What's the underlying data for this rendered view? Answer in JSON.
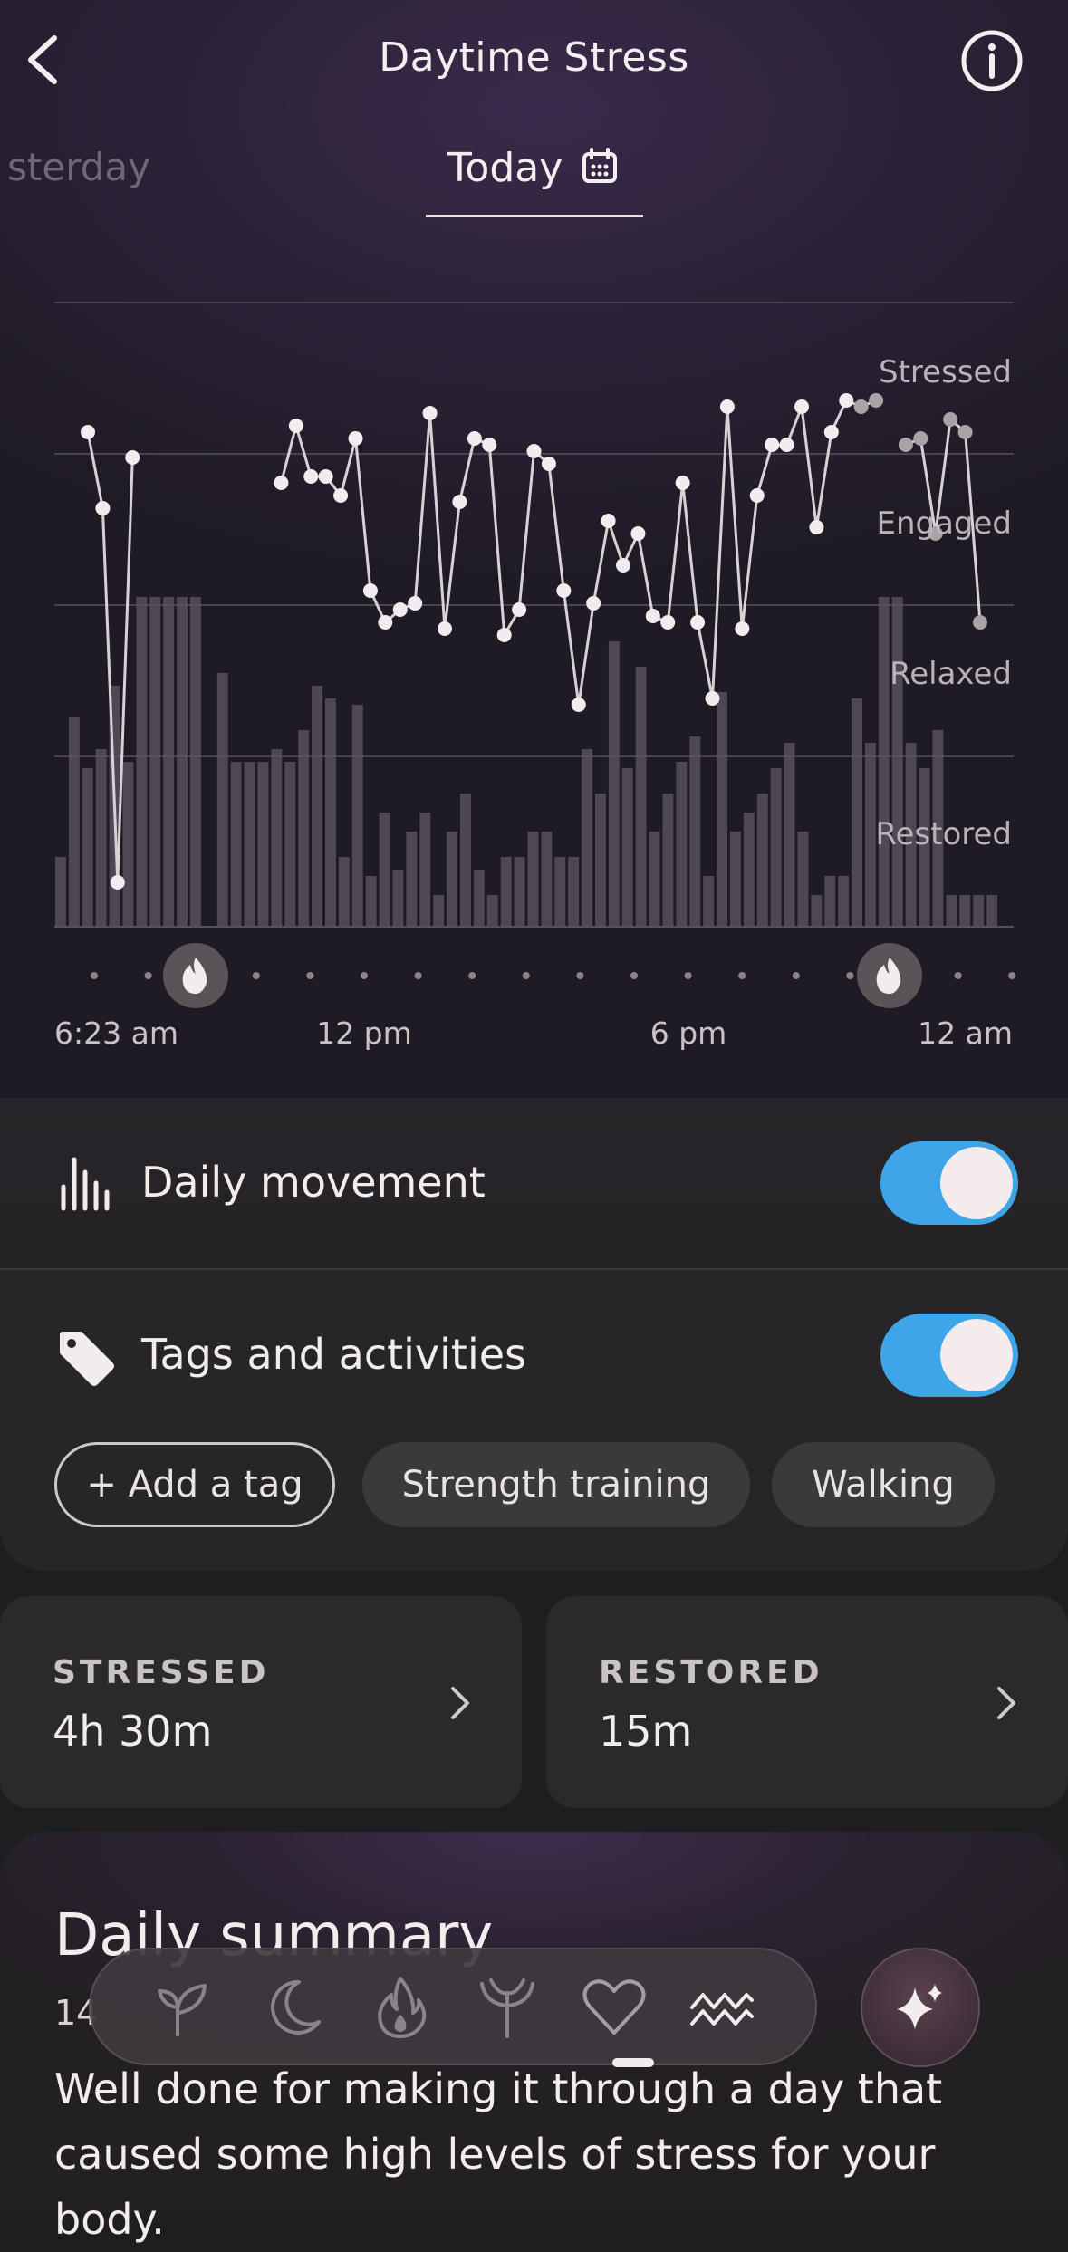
{
  "header": {
    "title": "Daytime Stress",
    "back_icon": "chevron-left-icon",
    "info_icon": "info-icon"
  },
  "tabs": {
    "previous_label": "sterday",
    "current_label": "Today",
    "calendar_icon": "calendar-icon"
  },
  "chart_data": {
    "type": "line",
    "y_levels": [
      "Stressed",
      "Engaged",
      "Relaxed",
      "Restored"
    ],
    "x_tick_labels": [
      "6:23 am",
      "12 pm",
      "6 pm",
      "12 am"
    ],
    "workout_markers": [
      "flame-icon",
      "flame-icon"
    ],
    "series": [
      {
        "kind": "stress-line",
        "values": [
          0.78,
          0.66,
          0.07,
          0.74,
          null,
          null,
          null,
          null,
          null,
          null,
          null,
          null,
          null,
          0.7,
          0.79,
          0.71,
          0.71,
          0.68,
          0.77,
          0.53,
          0.48,
          0.5,
          0.51,
          0.81,
          0.47,
          0.67,
          0.77,
          0.76,
          0.46,
          0.5,
          0.75,
          0.73,
          0.53,
          0.35,
          0.51,
          0.64,
          0.57,
          0.62,
          0.49,
          0.48,
          0.7,
          0.48,
          0.36,
          0.82,
          0.47,
          0.68,
          0.76,
          0.76,
          0.82,
          0.63,
          0.78,
          0.83,
          0.82,
          0.83,
          null,
          0.76,
          0.77,
          0.62,
          0.8,
          0.78,
          0.48
        ]
      },
      {
        "kind": "movement-bars",
        "values": [
          0.11,
          0.33,
          0.25,
          0.28,
          0.38,
          0.26,
          0.52,
          0.52,
          0.52,
          0.52,
          0.52,
          0.0,
          0.4,
          0.26,
          0.26,
          0.26,
          0.28,
          0.26,
          0.31,
          0.38,
          0.36,
          0.11,
          0.35,
          0.08,
          0.18,
          0.09,
          0.15,
          0.18,
          0.05,
          0.15,
          0.21,
          0.09,
          0.05,
          0.11,
          0.11,
          0.15,
          0.15,
          0.11,
          0.11,
          0.28,
          0.21,
          0.45,
          0.25,
          0.41,
          0.15,
          0.21,
          0.26,
          0.3,
          0.08,
          0.37,
          0.15,
          0.18,
          0.21,
          0.25,
          0.29,
          0.15,
          0.05,
          0.08,
          0.08,
          0.36,
          0.29,
          0.52,
          0.52,
          0.29,
          0.25,
          0.31,
          0.05,
          0.05,
          0.05,
          0.05
        ]
      }
    ]
  },
  "movement": {
    "icon": "activity-bars-icon",
    "label": "Daily movement",
    "toggle_on": true
  },
  "tags": {
    "icon": "tag-icon",
    "label": "Tags and activities",
    "toggle_on": true,
    "add_label": "+ Add a tag",
    "items": [
      "Strength training",
      "Walking"
    ]
  },
  "stats": {
    "stressed_label": "STRESSED",
    "stressed_value": "4h 30m",
    "restored_label": "RESTORED",
    "restored_value": "15m"
  },
  "summary": {
    "title": "Daily summary",
    "date": "14",
    "text": "Well done for making it through a day that caused some high levels of stress for your body."
  },
  "nav": {
    "items": [
      "sprout-icon",
      "moon-icon",
      "flame-icon",
      "cycle-icon",
      "heart-icon",
      "waves-icon"
    ],
    "active": "waves-icon",
    "ai_icon": "sparkle-icon"
  },
  "colors": {
    "accent_toggle": "#3ea6e8",
    "background": "#1e1d20",
    "chart_bg": "#2b2238"
  }
}
